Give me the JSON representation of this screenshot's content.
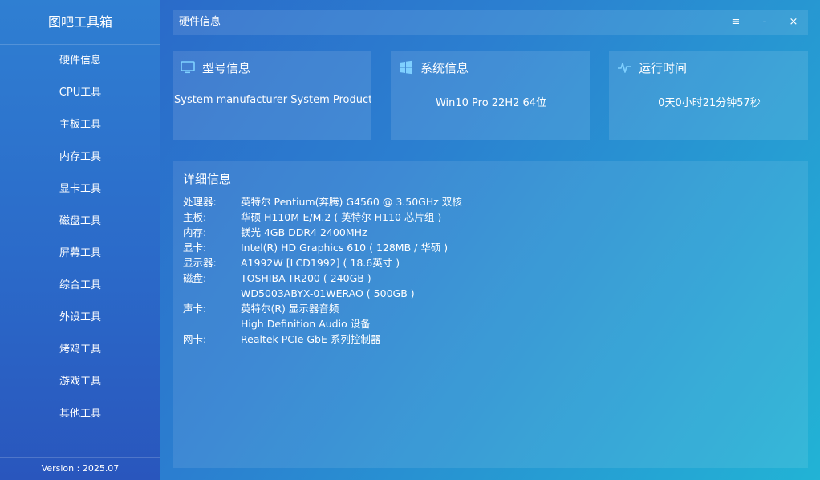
{
  "sidebar": {
    "app_title": "图吧工具箱",
    "items": [
      {
        "label": "硬件信息"
      },
      {
        "label": "CPU工具"
      },
      {
        "label": "主板工具"
      },
      {
        "label": "内存工具"
      },
      {
        "label": "显卡工具"
      },
      {
        "label": "磁盘工具"
      },
      {
        "label": "屏幕工具"
      },
      {
        "label": "综合工具"
      },
      {
        "label": "外设工具"
      },
      {
        "label": "烤鸡工具"
      },
      {
        "label": "游戏工具"
      },
      {
        "label": "其他工具"
      }
    ],
    "version": "Version : 2025.07"
  },
  "titlebar": {
    "title": "硬件信息",
    "menu_icon": "≡",
    "minimize_icon": "-",
    "close_icon": "×"
  },
  "cards": {
    "model": {
      "title": "型号信息",
      "value": "System manufacturer System Product N",
      "icon": "monitor-icon"
    },
    "system": {
      "title": "系统信息",
      "value": "Win10 Pro 22H2 64位",
      "icon": "windows-icon"
    },
    "uptime": {
      "title": "运行时间",
      "value": "0天0小时21分钟57秒",
      "icon": "pulse-icon"
    }
  },
  "detail": {
    "title": "详细信息",
    "rows": [
      {
        "label": "处理器:",
        "value": "英特尔 Pentium(奔腾) G4560 @ 3.50GHz 双核"
      },
      {
        "label": "主板:",
        "value": "华硕 H110M-E/M.2 ( 英特尔 H110 芯片组 )"
      },
      {
        "label": "内存:",
        "value": "镁光 4GB DDR4 2400MHz"
      },
      {
        "label": "显卡:",
        "value": "Intel(R) HD Graphics 610 ( 128MB / 华硕 )"
      },
      {
        "label": "显示器:",
        "value": "A1992W [LCD1992] ( 18.6英寸 )"
      },
      {
        "label": "磁盘:",
        "value": "TOSHIBA-TR200 ( 240GB )"
      },
      {
        "label": "",
        "value": "WD5003ABYX-01WERAO ( 500GB )"
      },
      {
        "label": "声卡:",
        "value": "英特尔(R) 显示器音频"
      },
      {
        "label": "",
        "value": "High Definition Audio 设备"
      },
      {
        "label": "网卡:",
        "value": "Realtek PCIe GbE 系列控制器"
      }
    ]
  }
}
